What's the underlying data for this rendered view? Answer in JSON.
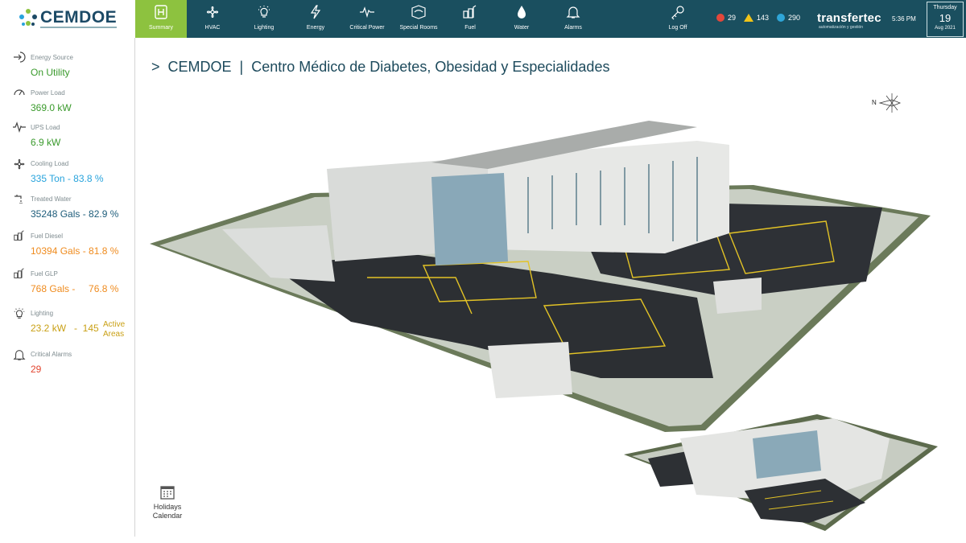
{
  "app": {
    "logo_text": "CEMDOE"
  },
  "nav": [
    {
      "label": "Summary",
      "icon": "summary-icon",
      "active": true
    },
    {
      "label": "HVAC",
      "icon": "fan-icon"
    },
    {
      "label": "Lighting",
      "icon": "lightbulb-icon"
    },
    {
      "label": "Energy",
      "icon": "lightning-icon"
    },
    {
      "label": "Critical Power",
      "icon": "pulse-icon"
    },
    {
      "label": "Special Rooms",
      "icon": "room-icon"
    },
    {
      "label": "Fuel",
      "icon": "fuel-tank-icon"
    },
    {
      "label": "Water",
      "icon": "water-drop-icon"
    },
    {
      "label": "Alarms",
      "icon": "bell-icon"
    }
  ],
  "logoff": {
    "label": "Log Off",
    "icon": "key-icon"
  },
  "alarm_counts": {
    "critical": "29",
    "warning": "143",
    "info": "290"
  },
  "brand": {
    "name": "transfertec",
    "tagline": "automatización y gestión"
  },
  "clock": {
    "time": "5:36 PM",
    "weekday": "Thursday",
    "day": "19",
    "month_year": "Aug 2021"
  },
  "sidebar": {
    "energy_source": {
      "title": "Energy Source",
      "value": "On Utility"
    },
    "power_load": {
      "title": "Power Load",
      "value": "369.0 kW"
    },
    "ups_load": {
      "title": "UPS Load",
      "value": "6.9 kW"
    },
    "cooling_load": {
      "title": "Cooling Load",
      "value": "335 Ton - 83.8 %"
    },
    "treated_water": {
      "title": "Treated Water",
      "value": "35248 Gals - 82.9 %"
    },
    "fuel_diesel": {
      "title": "Fuel Diesel",
      "value": "10394 Gals - 81.8 %"
    },
    "fuel_glp": {
      "title": "Fuel GLP",
      "value": "768 Gals -     76.8 %"
    },
    "lighting": {
      "title": "Lighting",
      "value": "23.2 kW   -  145",
      "suffix": "Active Areas"
    },
    "critical_alarms": {
      "title": "Critical Alarms",
      "value": "29"
    }
  },
  "holidays": {
    "label": "Holidays Calendar"
  },
  "main": {
    "title": ">  CEMDOE  |  Centro Médico de Diabetes, Obesidad y Especialidades",
    "compass_label": "N"
  },
  "colors": {
    "header_bg": "#1a4f5f",
    "active_nav": "#8dc23f",
    "accent_green": "#3a9a2c"
  }
}
